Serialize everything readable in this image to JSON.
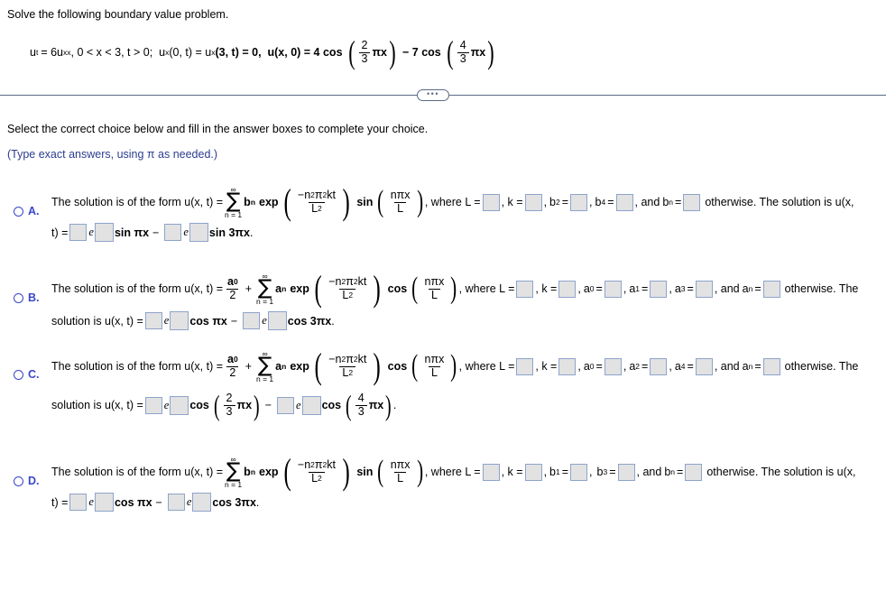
{
  "prompt": "Solve the following boundary value problem.",
  "problem": {
    "u_t": "u",
    "u_t_sub": "t",
    "eq_lead": "= 6u",
    "eq_lead_sub": "xx",
    "domain": ", 0 < x < 3, t > 0;  u",
    "bc1_sub": "x",
    "bc1": "(0, t) = u",
    "bc2_sub": "x",
    "bc2": "(3, t) = 0,  u(x, 0) = 4 cos",
    "frac1_num": "2",
    "frac1_den": "3",
    "pi_x_1": "πx",
    "minus_term": "− 7 cos",
    "frac2_num": "4",
    "frac2_den": "3",
    "pi_x_2": "πx"
  },
  "divider": {
    "ellipsis": "•••"
  },
  "instructions": {
    "select": "Select the correct choice below and fill in the answer boxes to complete your choice.",
    "type_exact": "(Type exact answers, using π as needed.)"
  },
  "common": {
    "form_lead": "The solution is of the form u(x, t) =",
    "sum_top": "∞",
    "sum_bottom": "n = 1",
    "sigma": "∑",
    "exp": "exp",
    "neg": "−",
    "n": "n",
    "two": "2",
    "pi": "π",
    "kt": "kt",
    "L": "L",
    "sin": "sin",
    "cos": "cos",
    "npix": "nπx",
    "a0": "a",
    "zero": "0",
    "half_den": "2",
    "plus": "+",
    "an": "a",
    "bn": "b",
    "n_sub": "n",
    "where": ", where L =",
    "k_eq": ", k =",
    "and": ", and",
    "eq": "=",
    "otherwise": "otherwise. The",
    "otherwise_long": "otherwise. The solution is u(x,",
    "sol_is": "solution is u(x, t) =",
    "t_eq": "t) =",
    "e": "e",
    "minus": "−",
    "period": ".",
    "comma": ",",
    "sin_pix": "sin πx",
    "sin_3pix": "sin 3πx",
    "cos_pix": "cos πx",
    "cos_3pix": "cos 3πx"
  },
  "choices": [
    {
      "id": "A",
      "label": "A.",
      "series_kind": "sin",
      "coef_symbol": "b",
      "has_a0_term": false,
      "coef_labels": [
        "b",
        "b",
        "b"
      ],
      "coef_subs": [
        "2",
        "4",
        "n"
      ],
      "tail": "otherwise. The solution is u(x,",
      "line2_lead": "t) =",
      "line2_term1": "sin πx",
      "line2_term2": "sin 3πx",
      "line2_fraction1": null,
      "line2_fraction2": null
    },
    {
      "id": "B",
      "label": "B.",
      "series_kind": "cos",
      "coef_symbol": "a",
      "has_a0_term": true,
      "coef_labels": [
        "a",
        "a",
        "a",
        "a"
      ],
      "coef_subs": [
        "0",
        "1",
        "3",
        "n"
      ],
      "tail": "otherwise. The",
      "line2_lead": "solution is u(x, t) =",
      "line2_term1": "cos πx",
      "line2_term2": "cos 3πx",
      "line2_fraction1": null,
      "line2_fraction2": null
    },
    {
      "id": "C",
      "label": "C.",
      "series_kind": "cos",
      "coef_symbol": "a",
      "has_a0_term": true,
      "coef_labels": [
        "a",
        "a",
        "a",
        "a"
      ],
      "coef_subs": [
        "0",
        "2",
        "4",
        "n"
      ],
      "tail": "otherwise. The",
      "line2_lead": "solution is u(x, t) =",
      "line2_term1": "cos",
      "line2_term2": "cos",
      "line2_fraction1": {
        "num": "2",
        "den": "3",
        "arg": "πx"
      },
      "line2_fraction2": {
        "num": "4",
        "den": "3",
        "arg": "πx"
      }
    },
    {
      "id": "D",
      "label": "D.",
      "series_kind": "sin",
      "coef_symbol": "b",
      "has_a0_term": false,
      "coef_labels": [
        "b",
        "b",
        "b"
      ],
      "coef_subs": [
        "1",
        "3",
        "n"
      ],
      "tail": "otherwise. The solution is u(x,",
      "line2_lead": "t) =",
      "line2_term1": "cos πx",
      "line2_term2": "cos 3πx",
      "line2_fraction1": null,
      "line2_fraction2": null
    }
  ],
  "colors": {
    "choice_blue": "#3a46c8",
    "hint_blue": "#2b3d8f",
    "box_fill": "#e2e2e2",
    "box_border": "#8ea4cc",
    "divider": "#5a6b87"
  }
}
